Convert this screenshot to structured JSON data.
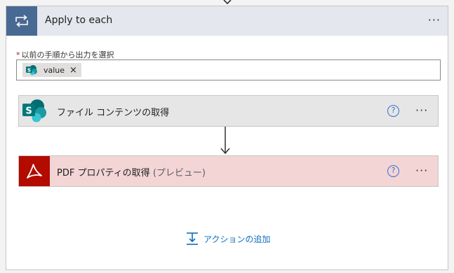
{
  "loop": {
    "title": "Apply to each",
    "icon": "loop-icon",
    "more_label": "···"
  },
  "field": {
    "required_mark": "*",
    "label": "以前の手順から出力を選択",
    "token": {
      "label": "value",
      "remove": "×",
      "icon": "sharepoint-icon"
    }
  },
  "actions": [
    {
      "title": "ファイル コンテンツの取得",
      "suffix": "",
      "icon": "sharepoint-icon",
      "help": "?",
      "more": "···",
      "color": "#e6e6e6"
    },
    {
      "title": "PDF プロパティの取得",
      "suffix": "(プレビュー)",
      "icon": "adobe-acrobat-icon",
      "help": "?",
      "more": "···",
      "color": "#f3d5d6"
    }
  ],
  "add_action": {
    "label": "アクションの追加",
    "icon": "add-action-icon"
  },
  "colors": {
    "header": "#e4e7ed",
    "loop_icon_bg": "#486991",
    "link": "#0f6cbd",
    "acrobat_red": "#b30b00"
  }
}
